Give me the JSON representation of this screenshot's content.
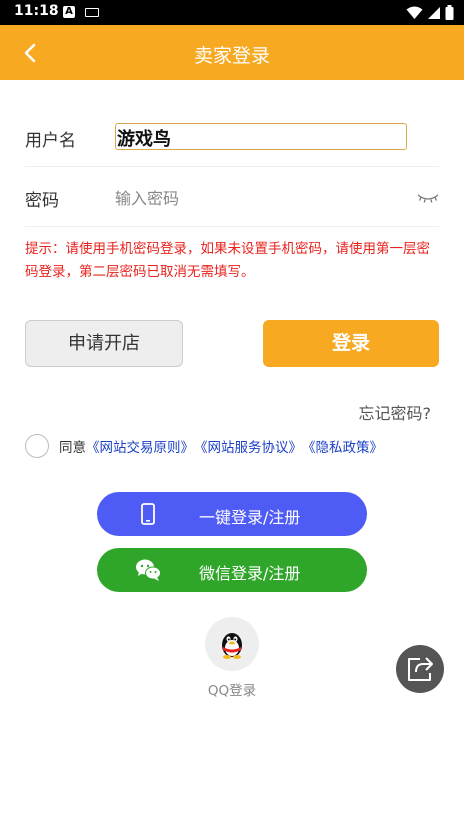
{
  "status_bar": {
    "time": "11:18",
    "notification_letter": "A",
    "icons": [
      "keyboard-icon",
      "wifi-icon",
      "signal-icon",
      "battery-icon"
    ]
  },
  "header": {
    "title": "卖家登录",
    "back_icon": "chevron-left-icon",
    "background_color": "#f7a921"
  },
  "form": {
    "username_label": "用户名",
    "username_value": "游戏鸟",
    "password_label": "密码",
    "password_placeholder": "输入密码",
    "visibility_icon": "eye-closed-icon"
  },
  "hint": "提示：请使用手机密码登录，如果未设置手机密码，请使用第一层密码登录，第二层密码已取消无需填写。",
  "buttons": {
    "apply_label": "申请开店",
    "login_label": "登录",
    "forgot_label": "忘记密码?"
  },
  "agreement": {
    "prefix": "同意",
    "links": [
      "《网站交易原则》",
      "《网站服务协议》",
      "《隐私政策》"
    ]
  },
  "social": {
    "onekey_label": "一键登录/注册",
    "wechat_label": "微信登录/注册",
    "qq_label": "QQ登录"
  },
  "colors": {
    "accent": "#f7a921",
    "hint_red": "#e8231e",
    "onekey_blue": "#4f5bf5",
    "wechat_green": "#2fa62a",
    "link_blue": "#1a3fc7"
  }
}
